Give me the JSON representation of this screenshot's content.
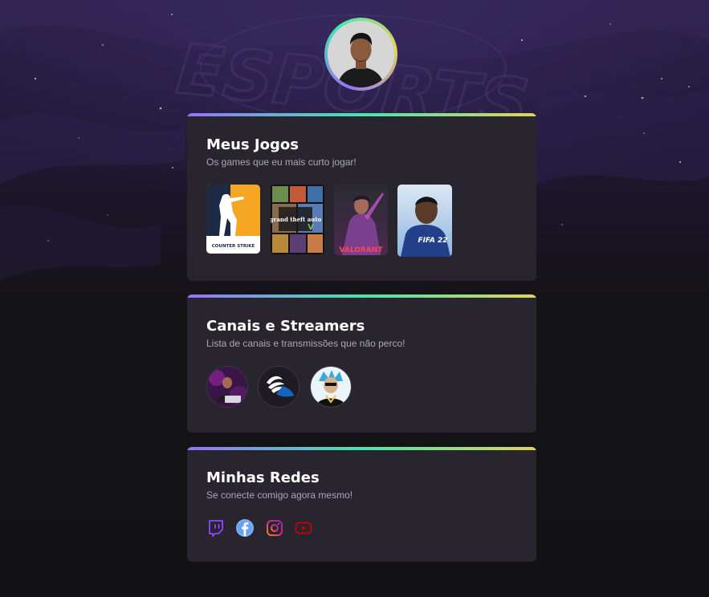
{
  "profile": {
    "avatar_icon": "profile-photo"
  },
  "background": {
    "watermark_text": "ESPORTS"
  },
  "games_section": {
    "title": "Meus Jogos",
    "subtitle": "Os games que eu mais curto jogar!",
    "games": [
      {
        "name": "Counter-Strike",
        "logo_text": "COUNTER STRIKE"
      },
      {
        "name": "Grand Theft Auto V",
        "logo_text": "grand theft auto"
      },
      {
        "name": "Valorant",
        "logo_text": "VALORANT"
      },
      {
        "name": "FIFA 22",
        "logo_text": "FIFA 22"
      }
    ]
  },
  "channels_section": {
    "title": "Canais e Streamers",
    "subtitle": "Lista de canais e transmissões que não perco!",
    "channels": [
      {
        "icon": "streamer-avatar"
      },
      {
        "icon": "winged-shoe-avatar"
      },
      {
        "icon": "cartoon-avatar"
      }
    ]
  },
  "social_section": {
    "title": "Minhas Redes",
    "subtitle": "Se conecte comigo agora mesmo!",
    "networks": [
      {
        "name": "twitch",
        "icon": "twitch-icon",
        "color": "#9146ff"
      },
      {
        "name": "facebook",
        "icon": "facebook-icon",
        "color": "#1877f2"
      },
      {
        "name": "instagram",
        "icon": "instagram-icon",
        "color": "#e1306c"
      },
      {
        "name": "youtube",
        "icon": "youtube-icon",
        "color": "#cc0000"
      }
    ]
  },
  "colors": {
    "card_bg": "#29252f",
    "gradient_start": "#9572fc",
    "gradient_mid": "#43e7ad",
    "gradient_end": "#e2d45c",
    "text_muted": "#a8a8b3"
  }
}
